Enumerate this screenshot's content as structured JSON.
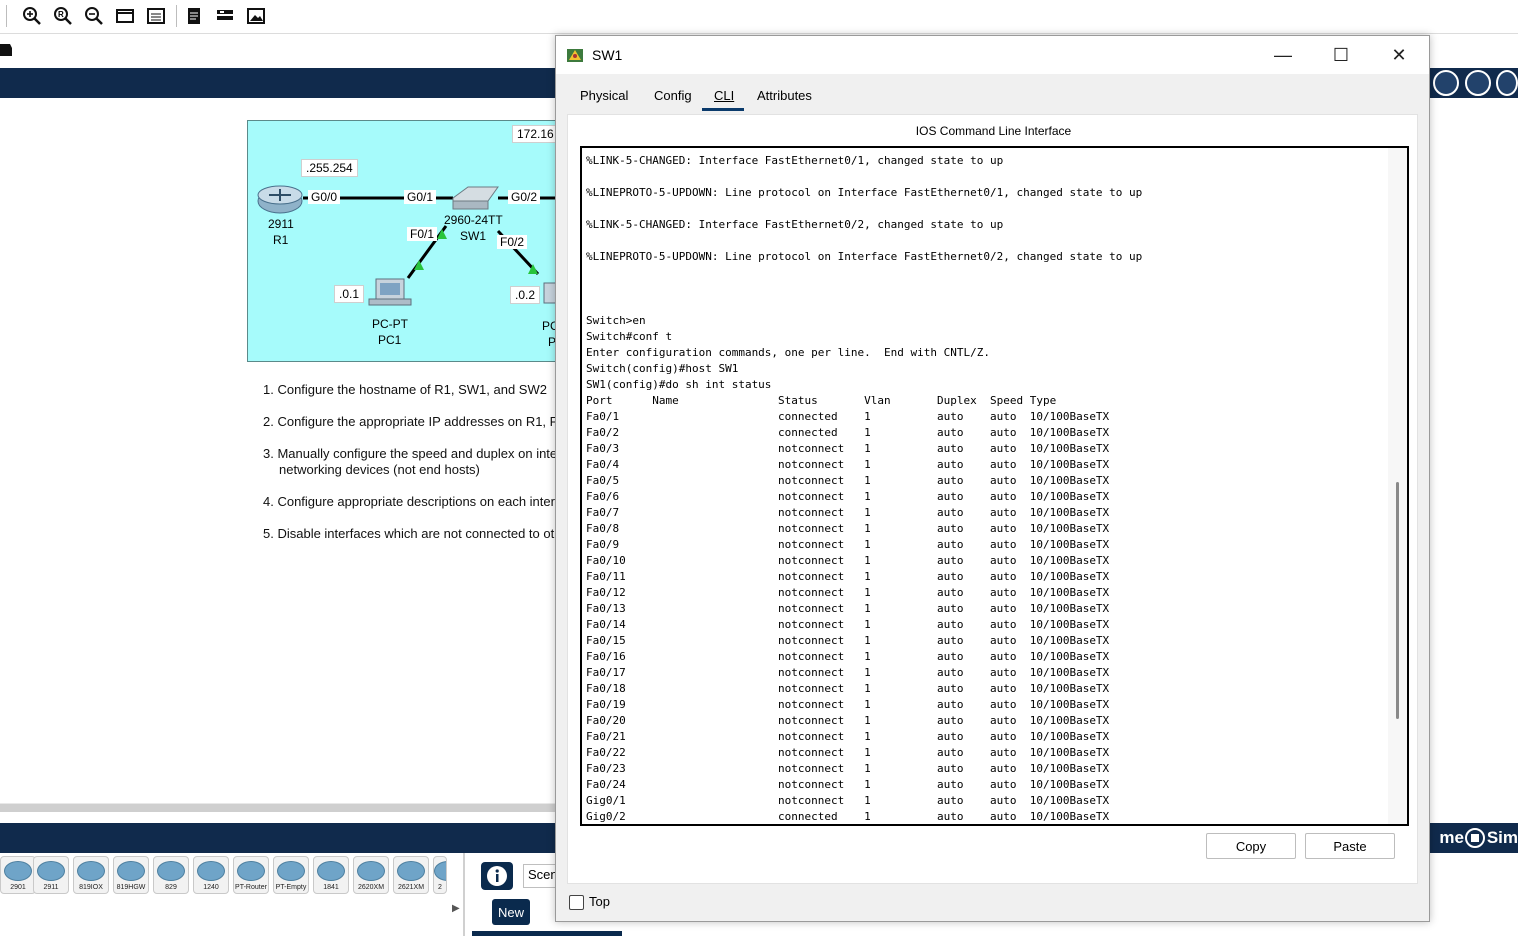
{
  "window": {
    "title": "SW1",
    "minimize_glyph": "—",
    "maximize_glyph": "☐",
    "close_glyph": "✕",
    "tabs": [
      "Physical",
      "Config",
      "CLI",
      "Attributes"
    ],
    "active_tab": "CLI",
    "cli_header": "IOS Command Line Interface",
    "terminal_lines": [
      "%LINK-5-CHANGED: Interface FastEthernet0/1, changed state to up",
      "",
      "%LINEPROTO-5-UPDOWN: Line protocol on Interface FastEthernet0/1, changed state to up",
      "",
      "%LINK-5-CHANGED: Interface FastEthernet0/2, changed state to up",
      "",
      "%LINEPROTO-5-UPDOWN: Line protocol on Interface FastEthernet0/2, changed state to up",
      "",
      "",
      "",
      "Switch>en",
      "Switch#conf t",
      "Enter configuration commands, one per line.  End with CNTL/Z.",
      "Switch(config)#host SW1",
      "SW1(config)#do sh int status",
      "Port      Name               Status       Vlan       Duplex  Speed Type",
      "Fa0/1                        connected    1          auto    auto  10/100BaseTX",
      "Fa0/2                        connected    1          auto    auto  10/100BaseTX",
      "Fa0/3                        notconnect   1          auto    auto  10/100BaseTX",
      "Fa0/4                        notconnect   1          auto    auto  10/100BaseTX",
      "Fa0/5                        notconnect   1          auto    auto  10/100BaseTX",
      "Fa0/6                        notconnect   1          auto    auto  10/100BaseTX",
      "Fa0/7                        notconnect   1          auto    auto  10/100BaseTX",
      "Fa0/8                        notconnect   1          auto    auto  10/100BaseTX",
      "Fa0/9                        notconnect   1          auto    auto  10/100BaseTX",
      "Fa0/10                       notconnect   1          auto    auto  10/100BaseTX",
      "Fa0/11                       notconnect   1          auto    auto  10/100BaseTX",
      "Fa0/12                       notconnect   1          auto    auto  10/100BaseTX",
      "Fa0/13                       notconnect   1          auto    auto  10/100BaseTX",
      "Fa0/14                       notconnect   1          auto    auto  10/100BaseTX",
      "Fa0/15                       notconnect   1          auto    auto  10/100BaseTX",
      "Fa0/16                       notconnect   1          auto    auto  10/100BaseTX",
      "Fa0/17                       notconnect   1          auto    auto  10/100BaseTX",
      "Fa0/18                       notconnect   1          auto    auto  10/100BaseTX",
      "Fa0/19                       notconnect   1          auto    auto  10/100BaseTX",
      "Fa0/20                       notconnect   1          auto    auto  10/100BaseTX",
      "Fa0/21                       notconnect   1          auto    auto  10/100BaseTX",
      "Fa0/22                       notconnect   1          auto    auto  10/100BaseTX",
      "Fa0/23                       notconnect   1          auto    auto  10/100BaseTX",
      "Fa0/24                       notconnect   1          auto    auto  10/100BaseTX",
      "Gig0/1                       notconnect   1          auto    auto  10/100BaseTX",
      "Gig0/2                       connected    1          auto    auto  10/100BaseTX"
    ],
    "scroll_fraction": 0.35,
    "copy_label": "Copy",
    "paste_label": "Paste",
    "top_label": "Top",
    "top_checked": false
  },
  "topology": {
    "network_label": "172.16",
    "r1_ip": ".255.254",
    "pc1_ip": ".0.1",
    "pc2_ip": ".0.2",
    "r1_model": "2911",
    "r1_name": "R1",
    "r1_port": "G0/0",
    "sw1_port_g01": "G0/1",
    "sw1_port_g02": "G0/2",
    "sw1_port_f01": "F0/1",
    "sw1_port_f02": "F0/2",
    "sw1_model": "2960-24TT",
    "sw1_name": "SW1",
    "pc1_model": "PC-PT",
    "pc1_name": "PC1",
    "pc2_model": "PC",
    "pc2_name": "P",
    "link_color": "#000000",
    "link_up_color": "#27c43b"
  },
  "tasks": [
    "1. Configure the hostname of R1, SW1, and SW2",
    "2. Configure the appropriate IP addresses on R1, F",
    "3. Manually configure the speed and duplex on inte",
    "networking devices (not end hosts)",
    "4. Configure appropriate descriptions on each interf",
    "5. Disable interfaces which are not connected to ot"
  ],
  "device_palette": [
    "2901",
    "2911",
    "819IOX",
    "819HGW",
    "829",
    "1240",
    "PT-Router",
    "PT-Empty",
    "1841",
    "2620XM",
    "2621XM",
    "2"
  ],
  "scenario": {
    "box_text": "Scen",
    "new_label": "New"
  },
  "right_panel": {
    "btn1_label": "me",
    "btn2_label": "Sim"
  },
  "colors": {
    "navy": "#102a4c",
    "topology_bg": "#a6fbfb",
    "tab_underline": "#0a3a6b"
  }
}
